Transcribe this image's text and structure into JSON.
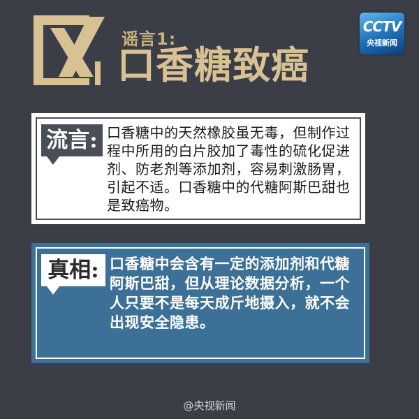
{
  "header": {
    "rumor_number": "谣言1:",
    "headline": "口香糖致癌",
    "icon": "cross-mark-icon"
  },
  "logo": {
    "mark": "CCTV",
    "subtitle": "央视新闻"
  },
  "rumor": {
    "label": "流言:",
    "text": "口香糖中的天然橡胶虽无毒，但制作过程中所用的白片胶加了毒性的硫化促进剂、防老剂等添加剂，容易刺激肠胃，引起不适。口香糖中的代糖阿斯巴甜也是致癌物。"
  },
  "truth": {
    "label": "真相:",
    "text": "口香糖中会含有一定的添加剂和代糖阿斯巴甜，但从理论数据分析，一个人只要不是每天成斤地摄入，就不会出现安全隐患。"
  },
  "footer": {
    "watermark": "@央视新闻"
  },
  "colors": {
    "background": "#3b3e47",
    "gold": "#d8c193",
    "truth_blue": "#3c7096",
    "label_dark": "#4a4e57"
  }
}
